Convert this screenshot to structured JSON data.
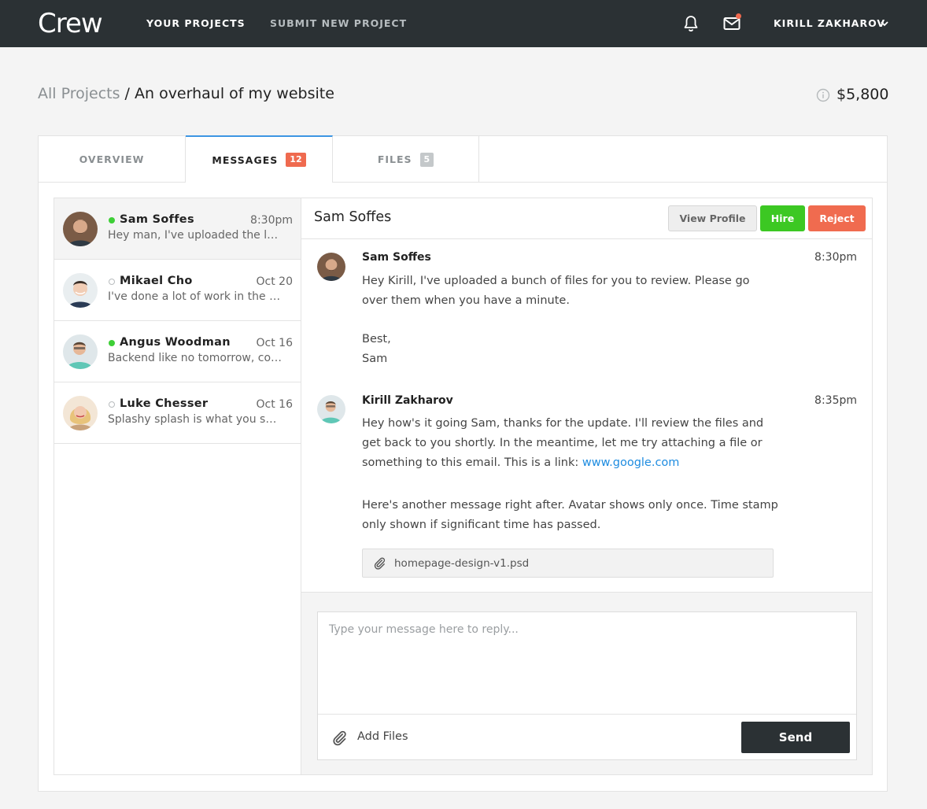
{
  "nav": {
    "logo": "Crew",
    "links": [
      "YOUR PROJECTS",
      "SUBMIT NEW PROJECT"
    ],
    "user_name": "KIRILL ZAKHAROV",
    "icons": [
      "bell-icon",
      "mail-icon",
      "chevron-down-icon"
    ],
    "notification_color": "#f0694e"
  },
  "breadcrumb": {
    "parent": "All Projects",
    "separator": " / ",
    "current": "An overhaul of my website"
  },
  "price": "$5,800",
  "tabs": [
    {
      "label": "OVERVIEW",
      "count": ""
    },
    {
      "label": "MESSAGES",
      "count": "12"
    },
    {
      "label": "FILES",
      "count": "5"
    }
  ],
  "conversations": [
    {
      "name": "Sam Soffes",
      "time": "8:30pm",
      "snippet": "Hey man, I've uploaded the lot of files for you to review",
      "online": true
    },
    {
      "name": "Mikael Cho",
      "time": "Oct 20",
      "snippet": "I've done a lot of work in the past few weeks on this",
      "online": false
    },
    {
      "name": "Angus Woodman",
      "time": "Oct 16",
      "snippet": "Backend like no tomorrow, count on me for that",
      "online": true
    },
    {
      "name": "Luke Chesser",
      "time": "Oct 16",
      "snippet": "Splashy splash is what you see here",
      "online": false
    }
  ],
  "thread": {
    "title": "Sam Soffes",
    "buttons": {
      "view_profile": "View Profile",
      "hire": "Hire",
      "reject": "Reject"
    },
    "messages": [
      {
        "author": "Sam Soffes",
        "time": "8:30pm",
        "paragraphs": [
          "Hey Kirill, I've uploaded a bunch of files for you to review. Please go over them when you have a minute.",
          "Best,",
          "Sam"
        ]
      },
      {
        "author": "Kirill Zakharov",
        "time": "8:35pm",
        "text_before_link": "Hey how's it going Sam, thanks for the update. I'll review the files and get back to you shortly. In the meantime, let me try attaching a file or something to this email. This is a link: ",
        "link": "www.google.com",
        "followup": "Here's another message right after. Avatar shows only once. Time stamp only shown if significant time has passed.",
        "attachment": "homepage-design-v1.psd"
      }
    ]
  },
  "composer": {
    "placeholder": "Type your message here to reply...",
    "add_files": "Add Files",
    "send": "Send"
  },
  "colors": {
    "nav_bg": "#2b3134",
    "accent": "#3d95e3",
    "hire": "#3cc823",
    "reject": "#f06b4f",
    "online": "#3ecf37",
    "link": "#1e8ce0"
  }
}
